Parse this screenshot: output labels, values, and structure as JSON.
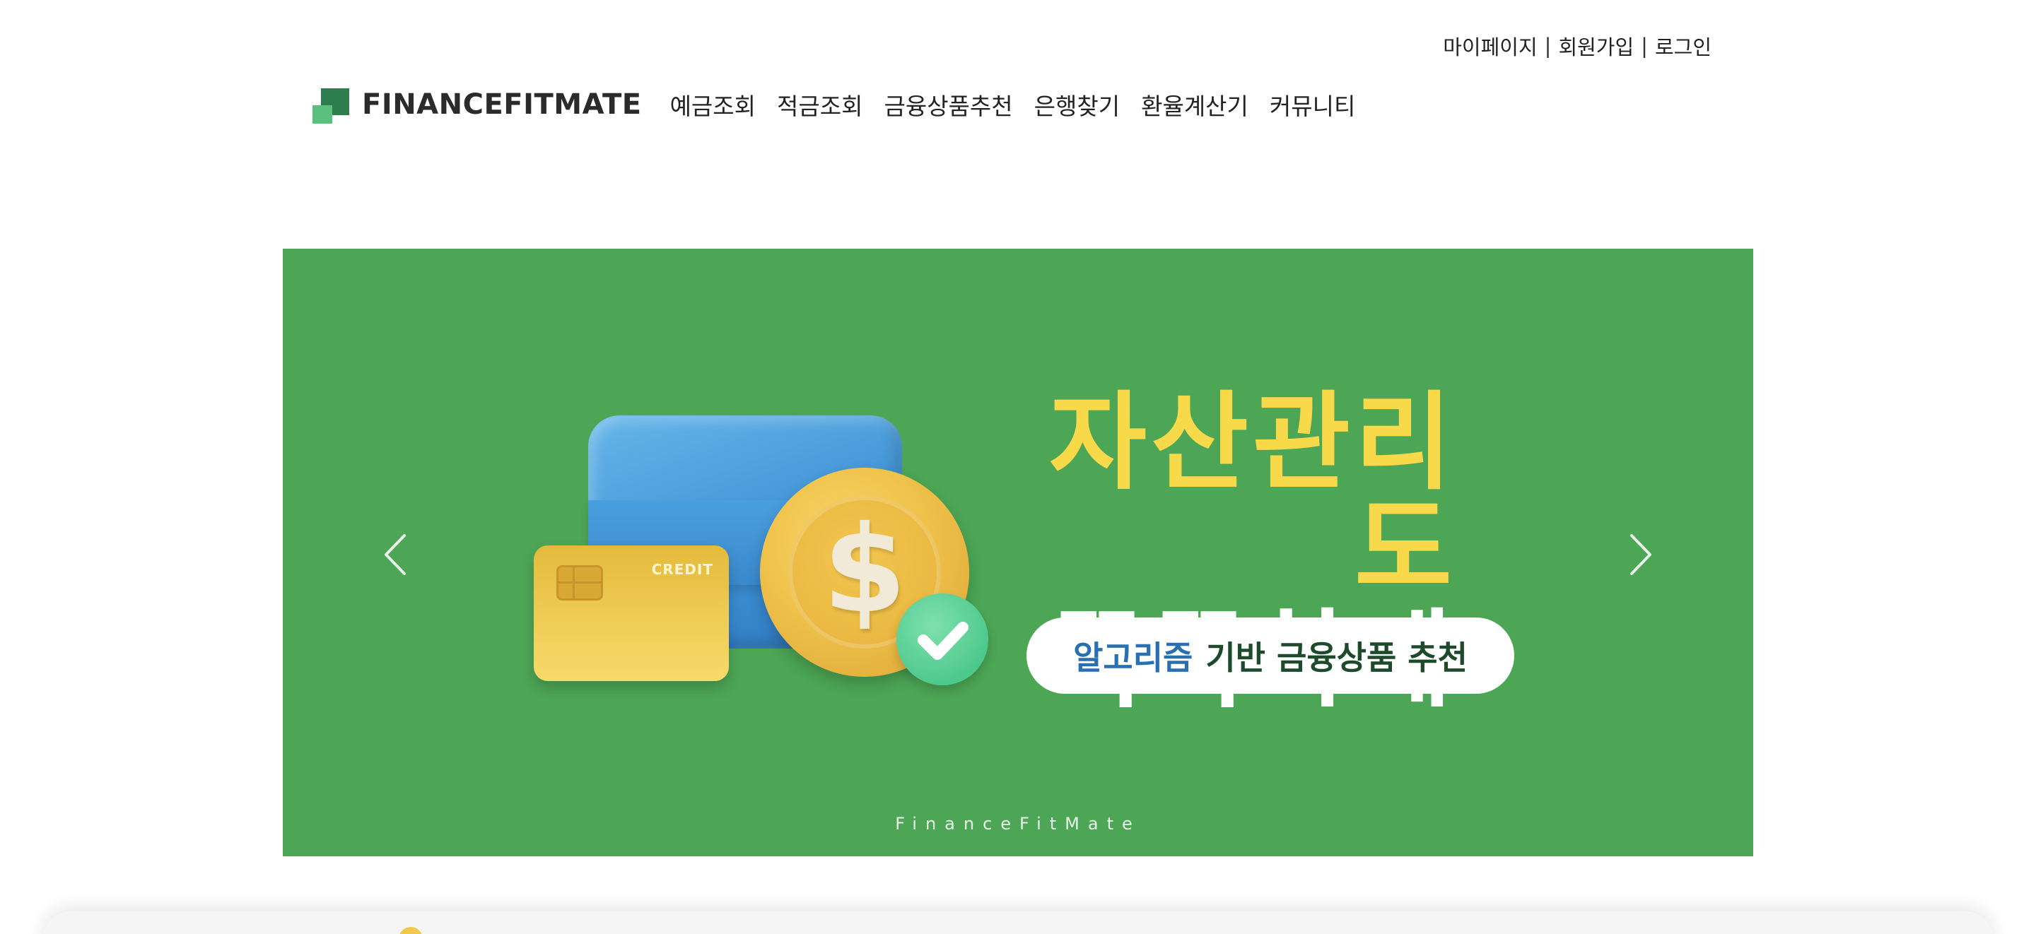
{
  "top_links": {
    "mypage": "마이페이지",
    "signup": "회원가입",
    "login": "로그인",
    "separator": "|"
  },
  "header": {
    "logo_text": "FINANCEFITMATE",
    "nav": [
      {
        "label": "예금조회"
      },
      {
        "label": "적금조회"
      },
      {
        "label": "금융상품추천"
      },
      {
        "label": "은행찾기"
      },
      {
        "label": "환율계산기"
      },
      {
        "label": "커뮤니티"
      }
    ]
  },
  "banner": {
    "headline_line1": "자산관리도",
    "headline_line2": "똑똑하게",
    "pill_highlight": "알고리즘",
    "pill_rest": "기반 금융상품 추천",
    "card_label": "CREDIT",
    "coin_symbol": "$",
    "footer_brand": "FinanceFitMate",
    "prev_icon": "chevron-left-icon",
    "next_icon": "chevron-right-icon",
    "background_color": "#4ca655",
    "accent_yellow": "#f7d94a"
  }
}
